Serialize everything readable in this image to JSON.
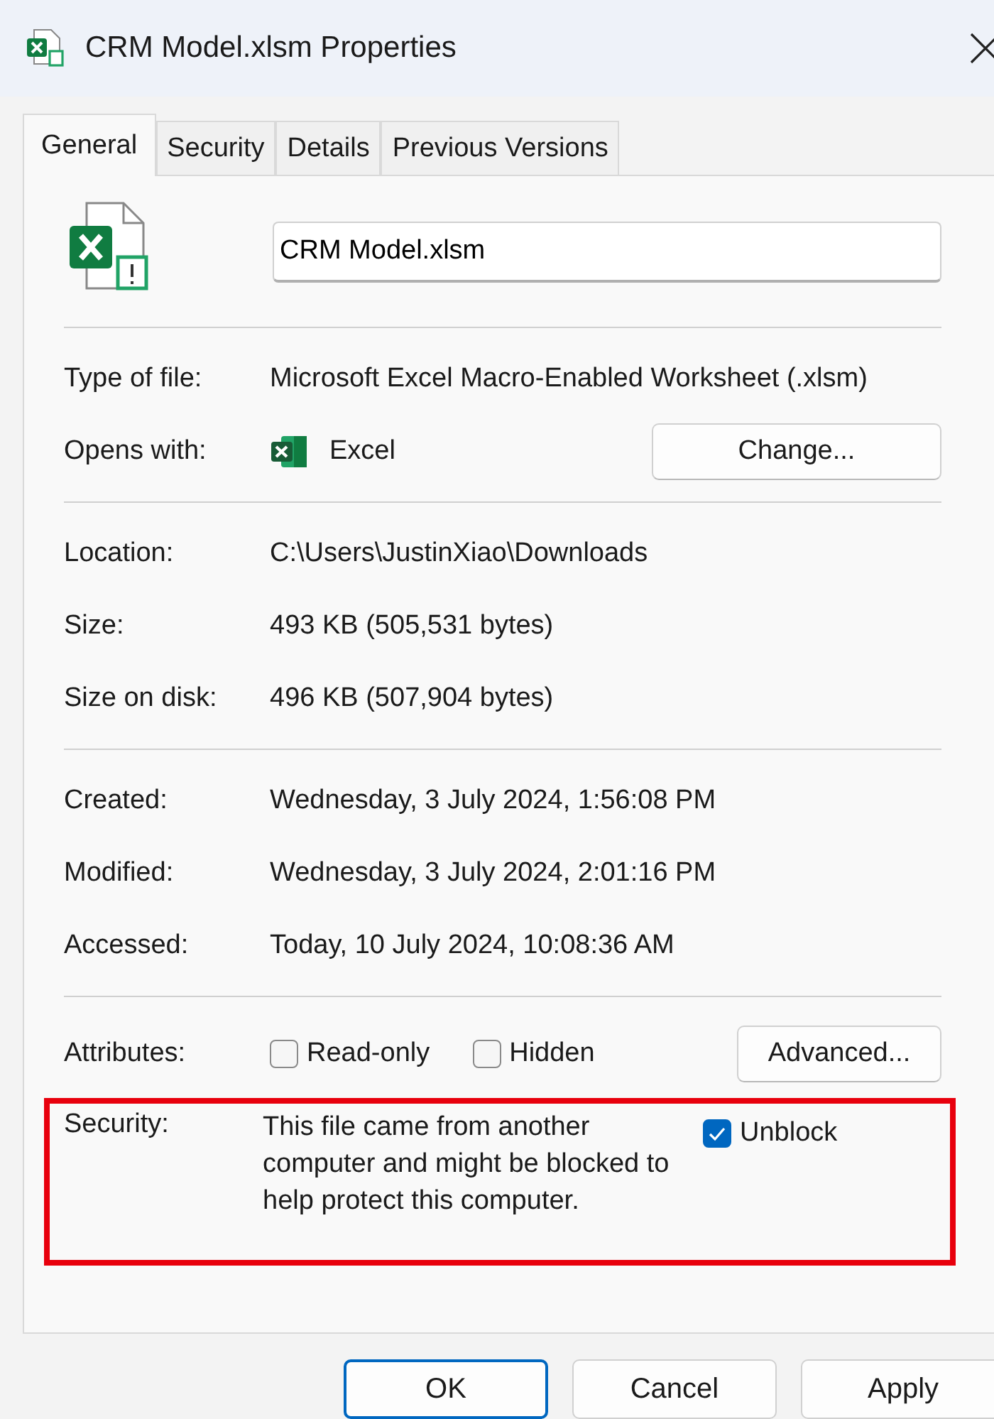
{
  "window": {
    "title": "CRM Model.xlsm Properties"
  },
  "tabs": [
    {
      "label": "General",
      "selected": true
    },
    {
      "label": "Security",
      "selected": false
    },
    {
      "label": "Details",
      "selected": false
    },
    {
      "label": "Previous Versions",
      "selected": false
    }
  ],
  "file_name": {
    "value": "CRM Model.xlsm"
  },
  "sections": [
    [
      {
        "label": "Type of file:",
        "value": "Microsoft Excel Macro-Enabled Worksheet (.xlsm)"
      },
      {
        "label": "Opens with:",
        "value": "Excel",
        "kind": "app",
        "button": "Change..."
      }
    ],
    [
      {
        "label": "Location:",
        "value": "C:\\Users\\JustinXiao\\Downloads"
      },
      {
        "label": "Size:",
        "value": "493 KB (505,531 bytes)"
      },
      {
        "label": "Size on disk:",
        "value": "496 KB (507,904 bytes)"
      }
    ],
    [
      {
        "label": "Created:",
        "value": "Wednesday, 3 July 2024, 1:56:08 PM"
      },
      {
        "label": "Modified:",
        "value": "Wednesday, 3 July 2024, 2:01:16 PM"
      },
      {
        "label": "Accessed:",
        "value": "Today, 10 July 2024, 10:08:36 AM"
      }
    ]
  ],
  "attributes": {
    "label": "Attributes:",
    "checkboxes": [
      {
        "label": "Read-only",
        "checked": false
      },
      {
        "label": "Hidden",
        "checked": false
      }
    ],
    "button": "Advanced..."
  },
  "security": {
    "label": "Security:",
    "highlighted": true,
    "text": "This file came from another computer and might be blocked to help protect this computer.",
    "checkbox": {
      "label": "Unblock",
      "checked": true
    }
  },
  "buttons": [
    {
      "label": "OK",
      "default": true
    },
    {
      "label": "Cancel",
      "default": false
    },
    {
      "label": "Apply",
      "default": false
    }
  ]
}
